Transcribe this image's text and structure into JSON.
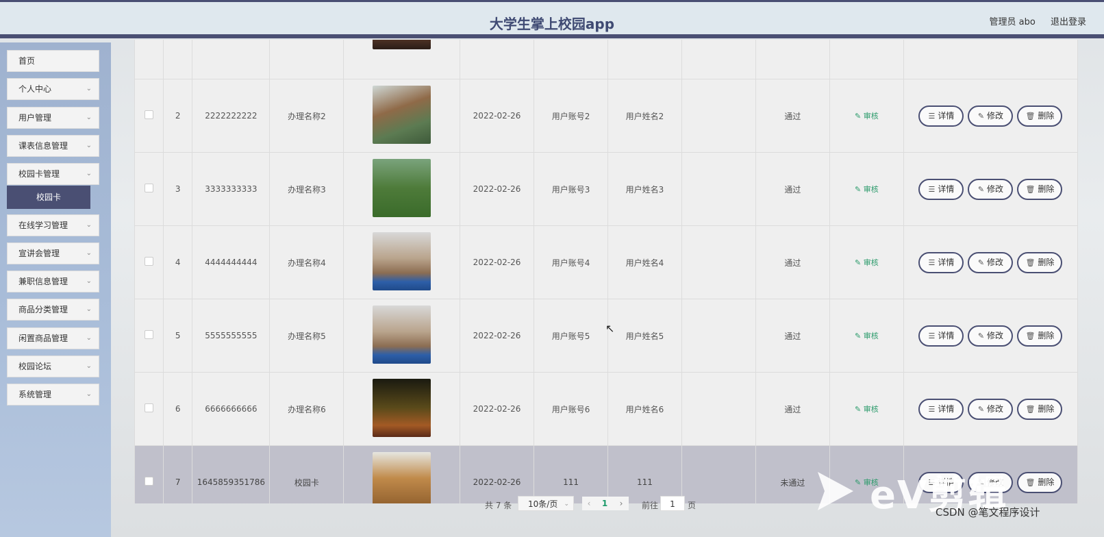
{
  "header": {
    "title": "大学生掌上校园app",
    "admin": "管理员 abo",
    "logout": "退出登录"
  },
  "sidebar": {
    "items": [
      {
        "label": "首页",
        "expandable": false
      },
      {
        "label": "个人中心",
        "expandable": true
      },
      {
        "label": "用户管理",
        "expandable": true
      },
      {
        "label": "课表信息管理",
        "expandable": true
      },
      {
        "label": "校园卡管理",
        "expandable": true
      },
      {
        "label": "在线学习管理",
        "expandable": true
      },
      {
        "label": "宣讲会管理",
        "expandable": true
      },
      {
        "label": "兼职信息管理",
        "expandable": true
      },
      {
        "label": "商品分类管理",
        "expandable": true
      },
      {
        "label": "闲置商品管理",
        "expandable": true
      },
      {
        "label": "校园论坛",
        "expandable": true
      },
      {
        "label": "系统管理",
        "expandable": true
      }
    ],
    "active_sub": "校园卡"
  },
  "table": {
    "rows": [
      {
        "idx": "",
        "card": "",
        "name": "",
        "date": "",
        "account": "",
        "username": "",
        "status": "",
        "audit": "",
        "thumb": "t1"
      },
      {
        "idx": "2",
        "card": "2222222222",
        "name": "办理名称2",
        "date": "2022-02-26",
        "account": "用户账号2",
        "username": "用户姓名2",
        "status": "通过",
        "audit": "审核",
        "thumb": "t2"
      },
      {
        "idx": "3",
        "card": "3333333333",
        "name": "办理名称3",
        "date": "2022-02-26",
        "account": "用户账号3",
        "username": "用户姓名3",
        "status": "通过",
        "audit": "审核",
        "thumb": "t3"
      },
      {
        "idx": "4",
        "card": "4444444444",
        "name": "办理名称4",
        "date": "2022-02-26",
        "account": "用户账号4",
        "username": "用户姓名4",
        "status": "通过",
        "audit": "审核",
        "thumb": "t4"
      },
      {
        "idx": "5",
        "card": "5555555555",
        "name": "办理名称5",
        "date": "2022-02-26",
        "account": "用户账号5",
        "username": "用户姓名5",
        "status": "通过",
        "audit": "审核",
        "thumb": "t4"
      },
      {
        "idx": "6",
        "card": "6666666666",
        "name": "办理名称6",
        "date": "2022-02-26",
        "account": "用户账号6",
        "username": "用户姓名6",
        "status": "通过",
        "audit": "审核",
        "thumb": "t6"
      },
      {
        "idx": "7",
        "card": "1645859351786",
        "name": "校园卡",
        "date": "2022-02-26",
        "account": "111",
        "username": "111",
        "status": "未通过",
        "audit": "审核",
        "thumb": "t7"
      }
    ],
    "actions": {
      "detail": "详情",
      "edit": "修改",
      "delete": "删除"
    }
  },
  "pagination": {
    "total": "共 7 条",
    "page_size": "10条/页",
    "current_page": "1",
    "goto_label": "前往",
    "goto_value": "1",
    "page_suffix": "页"
  },
  "watermark": {
    "brand": "eV剪辑",
    "credit": "CSDN @笔文程序设计"
  },
  "colors": {
    "accent": "#4a4f73",
    "audit": "#2a9a6a",
    "highlight_row": "#c0c0cb"
  }
}
